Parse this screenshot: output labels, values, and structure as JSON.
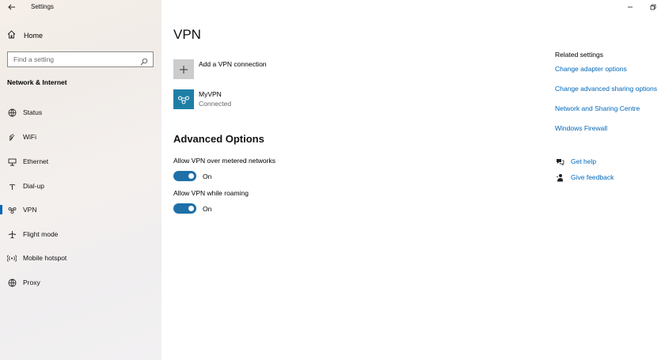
{
  "window": {
    "title": "Settings"
  },
  "sidebar": {
    "home_label": "Home",
    "search_placeholder": "Find a setting",
    "section_title": "Network & Internet",
    "items": [
      {
        "label": "Status",
        "icon": "globe-status-icon"
      },
      {
        "label": "WiFi",
        "icon": "wifi-icon"
      },
      {
        "label": "Ethernet",
        "icon": "ethernet-icon"
      },
      {
        "label": "Dial-up",
        "icon": "dial-up-icon"
      },
      {
        "label": "VPN",
        "icon": "vpn-icon",
        "active": true
      },
      {
        "label": "Flight mode",
        "icon": "airplane-icon"
      },
      {
        "label": "Mobile hotspot",
        "icon": "hotspot-icon"
      },
      {
        "label": "Proxy",
        "icon": "globe-icon"
      }
    ]
  },
  "main": {
    "title": "VPN",
    "add_vpn_label": "Add a VPN connection",
    "connection": {
      "name": "MyVPN",
      "status": "Connected"
    },
    "advanced_title": "Advanced Options",
    "options": [
      {
        "label": "Allow VPN over metered networks",
        "state": "On"
      },
      {
        "label": "Allow VPN while roaming",
        "state": "On"
      }
    ]
  },
  "related": {
    "title": "Related settings",
    "links": [
      "Change adapter options",
      "Change advanced sharing options",
      "Network and Sharing Centre",
      "Windows Firewall"
    ],
    "get_help": "Get help",
    "give_feedback": "Give feedback"
  },
  "colors": {
    "accent": "#0067b8",
    "toggle_on": "#1f6fa8",
    "vpn_tile": "#1e7fa6"
  }
}
